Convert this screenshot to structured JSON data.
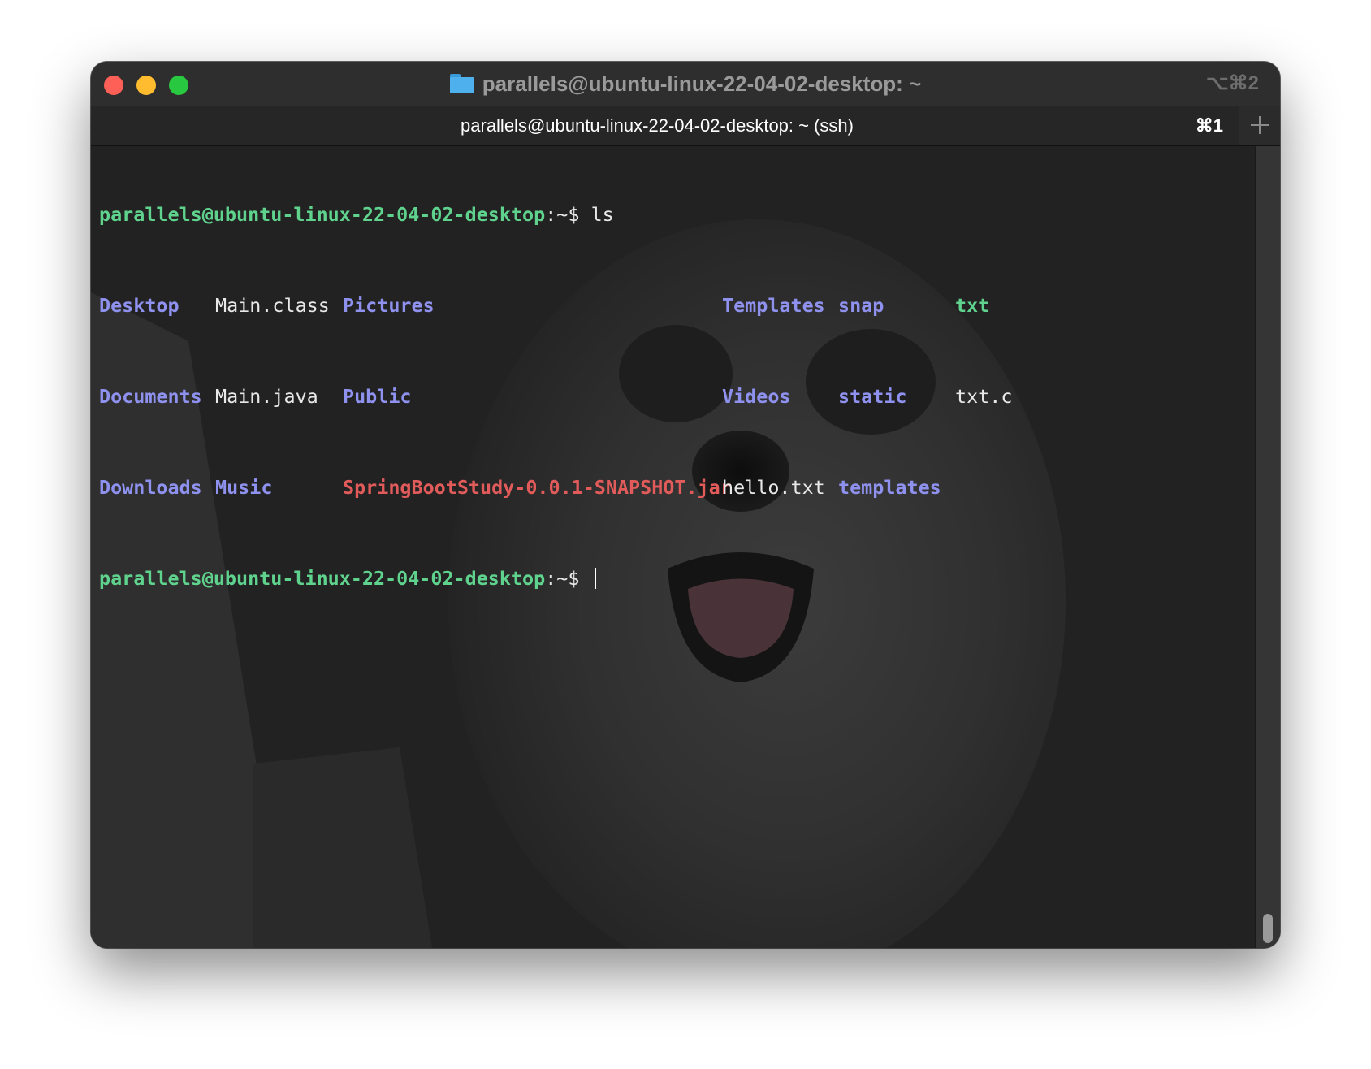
{
  "window": {
    "title": "parallels@ubuntu-linux-22-04-02-desktop: ~",
    "window_shortcut": "⌥⌘2"
  },
  "tab": {
    "title": "parallels@ubuntu-linux-22-04-02-desktop: ~ (ssh)",
    "shortcut": "⌘1"
  },
  "terminal": {
    "prompt_user": "parallels@ubuntu-linux-22-04-02-desktop",
    "prompt_path": ":~",
    "prompt_symbol": "$ ",
    "command": "ls",
    "listing": {
      "row1": [
        "Desktop",
        "Main.class",
        "Pictures",
        "Templates",
        "snap",
        "txt"
      ],
      "row2": [
        "Documents",
        "Main.java",
        "Public",
        "Videos",
        "static",
        "txt.c"
      ],
      "row3": [
        "Downloads",
        "Music",
        "SpringBootStudy-0.0.1-SNAPSHOT.jar",
        "hello.txt",
        "templates"
      ]
    }
  },
  "colors": {
    "prompt_user": "#5fd38d",
    "directory": "#8f91ee",
    "archive": "#e25b5b",
    "executable": "#5fd38d"
  }
}
